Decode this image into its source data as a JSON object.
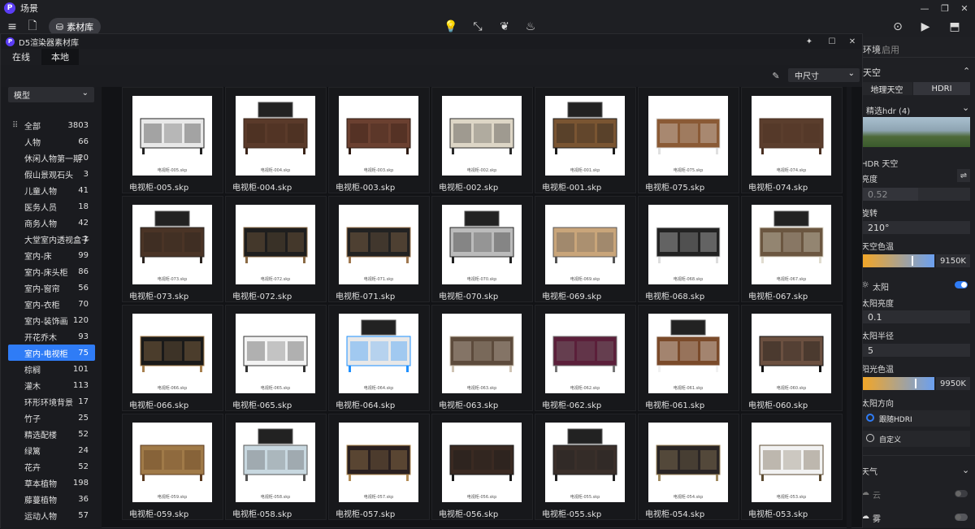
{
  "app": {
    "title": "场景",
    "logo_letter": "P"
  },
  "toolbar": {
    "material_button": "素材库"
  },
  "dialog": {
    "title": "D5渲染器素材库",
    "tabs": [
      {
        "label": "在线"
      },
      {
        "label": "本地"
      }
    ],
    "size_select": "中尺寸",
    "category_dropdown": "模型"
  },
  "categories": [
    {
      "label": "全部",
      "count": "3803"
    },
    {
      "label": "人物",
      "count": "66"
    },
    {
      "label": "休闲人物第一期",
      "count": "20"
    },
    {
      "label": "假山景观石头",
      "count": "3"
    },
    {
      "label": "儿童人物",
      "count": "41"
    },
    {
      "label": "医务人员",
      "count": "18"
    },
    {
      "label": "商务人物",
      "count": "42"
    },
    {
      "label": "大堂室内透视盒子",
      "count": "1"
    },
    {
      "label": "室内-床",
      "count": "99"
    },
    {
      "label": "室内-床头柜",
      "count": "86"
    },
    {
      "label": "室内-窗帘",
      "count": "56"
    },
    {
      "label": "室内-衣柜",
      "count": "70"
    },
    {
      "label": "室内-装饰画",
      "count": "120"
    },
    {
      "label": "开花乔木",
      "count": "93"
    },
    {
      "label": "室内-电视柜",
      "count": "75"
    },
    {
      "label": "棕榈",
      "count": "101"
    },
    {
      "label": "灌木",
      "count": "113"
    },
    {
      "label": "环形环境背景",
      "count": "17"
    },
    {
      "label": "竹子",
      "count": "25"
    },
    {
      "label": "精选配楼",
      "count": "52"
    },
    {
      "label": "绿篱",
      "count": "24"
    },
    {
      "label": "花卉",
      "count": "52"
    },
    {
      "label": "草本植物",
      "count": "198"
    },
    {
      "label": "藤蔓植物",
      "count": "36"
    },
    {
      "label": "运动人物",
      "count": "57"
    }
  ],
  "items": [
    {
      "name": "电视柜-005.skp",
      "mini": "电视柜-005.skp"
    },
    {
      "name": "电视柜-004.skp",
      "mini": "电视柜-004.skp"
    },
    {
      "name": "电视柜-003.skp",
      "mini": "电视柜-003.skp"
    },
    {
      "name": "电视柜-002.skp",
      "mini": "电视柜-002.skp"
    },
    {
      "name": "电视柜-001.skp",
      "mini": "电视柜-001.skp"
    },
    {
      "name": "电视柜-075.skp",
      "mini": "电视柜-075.skp"
    },
    {
      "name": "电视柜-074.skp",
      "mini": "电视柜-074.skp"
    },
    {
      "name": "电视柜-073.skp",
      "mini": "电视柜-073.skp"
    },
    {
      "name": "电视柜-072.skp",
      "mini": "电视柜-072.skp"
    },
    {
      "name": "电视柜-071.skp",
      "mini": "电视柜-071.skp"
    },
    {
      "name": "电视柜-070.skp",
      "mini": "电视柜-070.skp"
    },
    {
      "name": "电视柜-069.skp",
      "mini": "电视柜-069.skp"
    },
    {
      "name": "电视柜-068.skp",
      "mini": "电视柜-068.skp"
    },
    {
      "name": "电视柜-067.skp",
      "mini": "电视柜-067.skp"
    },
    {
      "name": "电视柜-066.skp",
      "mini": "电视柜-066.skp"
    },
    {
      "name": "电视柜-065.skp",
      "mini": "电视柜-065.skp"
    },
    {
      "name": "电视柜-064.skp",
      "mini": "电视柜-064.skp"
    },
    {
      "name": "电视柜-063.skp",
      "mini": "电视柜-063.skp"
    },
    {
      "name": "电视柜-062.skp",
      "mini": "电视柜-062.skp"
    },
    {
      "name": "电视柜-061.skp",
      "mini": "电视柜-061.skp"
    },
    {
      "name": "电视柜-060.skp",
      "mini": "电视柜-060.skp"
    },
    {
      "name": "电视柜-059.skp",
      "mini": "电视柜-059.skp"
    },
    {
      "name": "电视柜-058.skp",
      "mini": "电视柜-058.skp"
    },
    {
      "name": "电视柜-057.skp",
      "mini": "电视柜-057.skp"
    },
    {
      "name": "电视柜-056.skp",
      "mini": "电视柜-056.skp"
    },
    {
      "name": "电视柜-055.skp",
      "mini": "电视柜-055.skp"
    },
    {
      "name": "电视柜-054.skp",
      "mini": "电视柜-054.skp"
    },
    {
      "name": "电视柜-053.skp",
      "mini": "电视柜-053.skp"
    }
  ],
  "right_panel": {
    "tab_env": "环境",
    "tab_start": "启用",
    "sky_header": "天空",
    "sky_tab_geo": "地理天空",
    "sky_tab_hdri": "HDRI",
    "hdri_select": "精选hdr (4)",
    "hdr_sky": "HDR 天空",
    "brightness_label": "亮度",
    "brightness_value": "0.52",
    "rotation_label": "旋转",
    "rotation_value": "210°",
    "sky_temp_label": "天空色温",
    "sky_temp_value": "9150K",
    "sun_label": "太阳",
    "sun_brightness_label": "太阳亮度",
    "sun_brightness_value": "0.1",
    "sun_radius_label": "太阳半径",
    "sun_radius_value": "5",
    "sun_temp_label": "阳光色温",
    "sun_temp_value": "9950K",
    "sun_dir_label": "太阳方向",
    "follow_hdri": "跟随HDRI",
    "custom": "自定义",
    "weather_header": "天气",
    "cloud_label": "云",
    "fog_label": "雾",
    "sky_temp_fraction": 0.7,
    "sun_temp_fraction": 0.75,
    "brightness_fraction": 0.52,
    "accent": "#2f7cf6"
  }
}
